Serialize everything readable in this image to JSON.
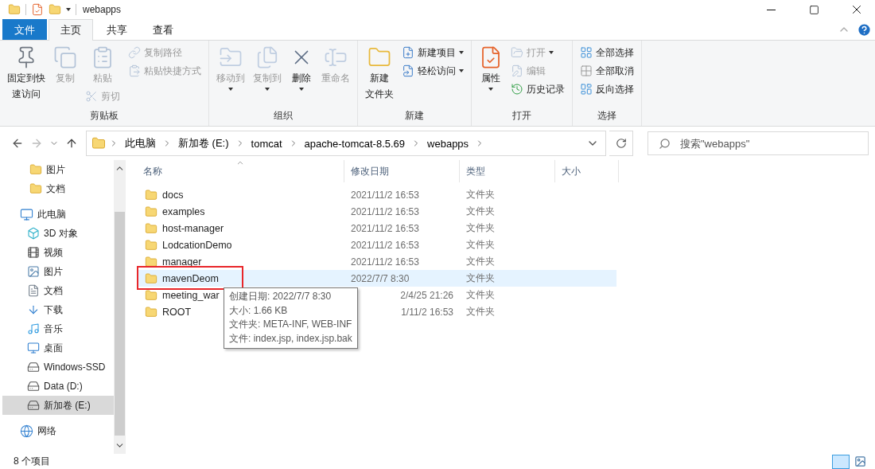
{
  "window": {
    "title": "webapps"
  },
  "ribbon_tabs": [
    {
      "label": "文件",
      "kind": "file",
      "selected": false
    },
    {
      "label": "主页",
      "kind": "tab",
      "selected": true
    },
    {
      "label": "共享",
      "kind": "tab",
      "selected": false
    },
    {
      "label": "查看",
      "kind": "tab",
      "selected": false
    }
  ],
  "ribbon_groups": [
    {
      "label": "剪贴板",
      "columns": [
        [
          {
            "label_lines": [
              "固定到快",
              "速访问"
            ],
            "kind": "large",
            "disabled": false,
            "dropdown": false
          }
        ],
        [
          {
            "label": "复制",
            "kind": "large",
            "disabled": true,
            "dropdown": false
          }
        ],
        [
          {
            "label": "粘贴",
            "kind": "large",
            "disabled": true,
            "dropdown": false
          },
          {
            "label": "剪切",
            "kind": "small",
            "disabled": true,
            "dropdown": false
          }
        ],
        [
          {
            "label": "复制路径",
            "kind": "small",
            "disabled": true,
            "dropdown": false
          },
          {
            "label": "粘贴快捷方式",
            "kind": "small",
            "disabled": true,
            "dropdown": false
          }
        ]
      ]
    },
    {
      "label": "组织",
      "columns": [
        [
          {
            "label": "移动到",
            "kind": "large",
            "disabled": true,
            "dropdown": true
          }
        ],
        [
          {
            "label": "复制到",
            "kind": "large",
            "disabled": true,
            "dropdown": true
          }
        ],
        [
          {
            "label": "删除",
            "kind": "large",
            "disabled": false,
            "dropdown": true
          }
        ],
        [
          {
            "label": "重命名",
            "kind": "large",
            "disabled": true,
            "dropdown": false
          }
        ]
      ]
    },
    {
      "label": "新建",
      "columns": [
        [
          {
            "label_lines": [
              "新建",
              "文件夹"
            ],
            "kind": "large",
            "disabled": false,
            "dropdown": false
          }
        ],
        [
          {
            "label": "新建项目",
            "kind": "small",
            "disabled": false,
            "dropdown": true
          },
          {
            "label": "轻松访问",
            "kind": "small",
            "disabled": false,
            "dropdown": true
          }
        ]
      ]
    },
    {
      "label": "打开",
      "columns": [
        [
          {
            "label": "属性",
            "kind": "large",
            "disabled": false,
            "dropdown": true
          }
        ],
        [
          {
            "label": "打开",
            "kind": "small",
            "disabled": true,
            "dropdown": true
          },
          {
            "label": "编辑",
            "kind": "small",
            "disabled": true,
            "dropdown": false
          },
          {
            "label": "历史记录",
            "kind": "small",
            "disabled": false,
            "dropdown": false
          }
        ]
      ]
    },
    {
      "label": "选择",
      "columns": [
        [
          {
            "label": "全部选择",
            "kind": "small",
            "disabled": false,
            "dropdown": false
          },
          {
            "label": "全部取消",
            "kind": "small",
            "disabled": false,
            "dropdown": false
          },
          {
            "label": "反向选择",
            "kind": "small",
            "disabled": false,
            "dropdown": false
          }
        ]
      ]
    }
  ],
  "address_bar": {
    "segments": [
      "此电脑",
      "新加卷 (E:)",
      "tomcat",
      "apache-tomcat-8.5.69",
      "webapps"
    ]
  },
  "search": {
    "placeholder": "搜索\"webapps\""
  },
  "nav_pane": {
    "pinned_items": [
      {
        "label": "图片",
        "selected": false
      },
      {
        "label": "文档",
        "selected": false
      }
    ],
    "tree": [
      {
        "label": "此电脑",
        "selected": false,
        "children": [
          {
            "label": "3D 对象",
            "selected": false
          },
          {
            "label": "视频",
            "selected": false
          },
          {
            "label": "图片",
            "selected": false
          },
          {
            "label": "文档",
            "selected": false
          },
          {
            "label": "下载",
            "selected": false
          },
          {
            "label": "音乐",
            "selected": false
          },
          {
            "label": "桌面",
            "selected": false
          },
          {
            "label": "Windows-SSD",
            "selected": false
          },
          {
            "label": "Data (D:)",
            "selected": false
          },
          {
            "label": "新加卷 (E:)",
            "selected": true
          }
        ]
      },
      {
        "label": "网络",
        "selected": false
      }
    ]
  },
  "file_list": {
    "columns": [
      {
        "label": "名称",
        "sorted": true
      },
      {
        "label": "修改日期",
        "sorted": false
      },
      {
        "label": "类型",
        "sorted": false
      },
      {
        "label": "大小",
        "sorted": false
      }
    ],
    "rows": [
      {
        "name": "docs",
        "date": "2021/11/2 16:53",
        "type": "文件夹",
        "hovered": false,
        "highlighted": false,
        "date_covered": false
      },
      {
        "name": "examples",
        "date": "2021/11/2 16:53",
        "type": "文件夹",
        "hovered": false,
        "highlighted": false,
        "date_covered": false
      },
      {
        "name": "host-manager",
        "date": "2021/11/2 16:53",
        "type": "文件夹",
        "hovered": false,
        "highlighted": false,
        "date_covered": false
      },
      {
        "name": "LodcationDemo",
        "date": "2021/11/2 16:53",
        "type": "文件夹",
        "hovered": false,
        "highlighted": false,
        "date_covered": false
      },
      {
        "name": "manager",
        "date": "2021/11/2 16:53",
        "type": "文件夹",
        "hovered": false,
        "highlighted": false,
        "date_covered": false
      },
      {
        "name": "mavenDeom",
        "date": "2022/7/7 8:30",
        "type": "文件夹",
        "hovered": true,
        "highlighted": true,
        "date_covered": false
      },
      {
        "name": "meeting_war",
        "date": "2/4/25 21:26",
        "type": "文件夹",
        "hovered": false,
        "highlighted": false,
        "date_covered": true
      },
      {
        "name": "ROOT",
        "date": "1/11/2 16:53",
        "type": "文件夹",
        "hovered": false,
        "highlighted": false,
        "date_covered": true
      }
    ]
  },
  "tooltip": {
    "lines": [
      "创建日期: 2022/7/7 8:30",
      "大小: 1.66 KB",
      "文件夹: META-INF, WEB-INF",
      "文件: index.jsp, index.jsp.bak"
    ]
  },
  "status_bar": {
    "item_count": "8 个项目",
    "views": [
      {
        "kind": "details",
        "selected": true
      },
      {
        "kind": "large-icons",
        "selected": false
      }
    ]
  }
}
